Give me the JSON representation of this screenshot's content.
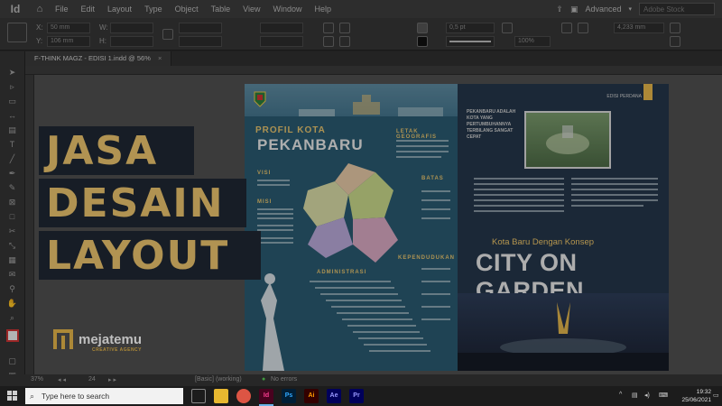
{
  "menubar": {
    "logo": "Id",
    "items": [
      "File",
      "Edit",
      "Layout",
      "Type",
      "Object",
      "Table",
      "View",
      "Window",
      "Help"
    ],
    "workspace": "Advanced",
    "stock_placeholder": "Adobe Stock"
  },
  "controlbar": {
    "x_label": "X:",
    "x_value": "50 mm",
    "y_label": "Y:",
    "y_value": "106 mm",
    "w_label": "W:",
    "h_label": "H:",
    "stroke_weight": "0,5 pt",
    "opacity": "100%",
    "dimension": "4,233 mm"
  },
  "document_tab": {
    "title": "F-THINK MAGZ - EDISI 1.indd @ 56%",
    "close": "×"
  },
  "overlay": {
    "line1": "JASA",
    "line2": "DESAIN",
    "line3": "LAYOUT",
    "brand_name": "mejatemu",
    "brand_tagline": "CREATIVE AGENCY"
  },
  "spread": {
    "left": {
      "title_small": "PROFIL KOTA",
      "title_big": "PEKANBARU",
      "headings": [
        "LETAK GEOGRAFIS",
        "VISI",
        "MISI",
        "BATAS",
        "ADMINISTRASI",
        "KEPENDUDUKAN"
      ]
    },
    "right": {
      "label": "EDISI PERDANA",
      "caption": "PEKANBARU ADALAH KOTA YANG PERTUMBUHANNYA TERBILANG SANGAT CEPAT",
      "subtitle": "Kota Baru Dengan Konsep",
      "headline": "CITY ON GARDEN"
    }
  },
  "statusbar": {
    "zoom": "37%",
    "page": "24",
    "mode": "[Basic] (working)",
    "errors": "No errors"
  },
  "taskbar": {
    "search_placeholder": "Type here to search",
    "apps": [
      {
        "label": "",
        "color": "#e8b830"
      },
      {
        "label": "",
        "color": "#dd5544"
      },
      {
        "label": "Id",
        "color": "#49021f"
      },
      {
        "label": "Ps",
        "color": "#001e36"
      },
      {
        "label": "Ai",
        "color": "#330000"
      },
      {
        "label": "Ae",
        "color": "#00005b"
      },
      {
        "label": "Pr",
        "color": "#00005b"
      }
    ],
    "time": "19:32",
    "date": "25/06/2021"
  },
  "colors": {
    "accent_gold": "#ecc56e",
    "overlay_box": "#1f2733"
  }
}
